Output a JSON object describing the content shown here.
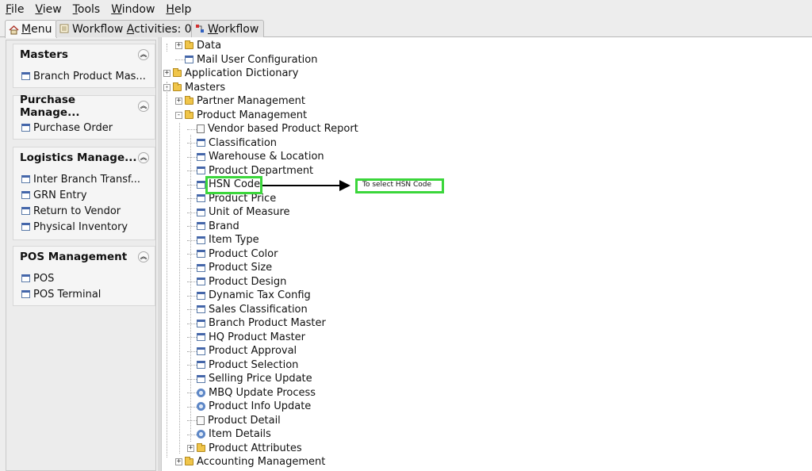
{
  "menubar": [
    {
      "pre": "",
      "ul": "F",
      "post": "ile"
    },
    {
      "pre": "",
      "ul": "V",
      "post": "iew"
    },
    {
      "pre": "",
      "ul": "T",
      "post": "ools"
    },
    {
      "pre": "",
      "ul": "W",
      "post": "indow"
    },
    {
      "pre": "",
      "ul": "H",
      "post": "elp"
    }
  ],
  "tabs": [
    {
      "label_ul": "M",
      "label_rest": "enu",
      "icon": "home-icon"
    },
    {
      "label_pre": "Workflow ",
      "label_ul": "A",
      "label_rest": "ctivities: 0",
      "icon": "list-icon"
    },
    {
      "label_ul": "W",
      "label_rest": "orkflow",
      "icon": "workflow-icon"
    }
  ],
  "sections": [
    {
      "title": "Masters",
      "items": [
        {
          "label": "Branch Product Mas...",
          "icon": "window-icon"
        }
      ]
    },
    {
      "title": "Purchase Manage...",
      "items": [
        {
          "label": "Purchase Order",
          "icon": "window-icon"
        }
      ]
    },
    {
      "title": "Logistics Manage...",
      "items": [
        {
          "label": "Inter Branch Transf...",
          "icon": "window-icon"
        },
        {
          "label": "GRN Entry",
          "icon": "window-icon"
        },
        {
          "label": "Return to Vendor",
          "icon": "window-icon"
        },
        {
          "label": "Physical Inventory",
          "icon": "window-icon"
        }
      ]
    },
    {
      "title": "POS Management",
      "items": [
        {
          "label": "POS",
          "icon": "window-icon"
        },
        {
          "label": "POS Terminal",
          "icon": "window-icon"
        }
      ]
    }
  ],
  "tree": [
    {
      "label": "Data",
      "icon": "folder",
      "expander": "+",
      "level": 1
    },
    {
      "label": "Mail User Configuration",
      "icon": "window",
      "expander": "",
      "level": 1
    },
    {
      "label": "Application Dictionary",
      "icon": "folder",
      "expander": "+",
      "level": 0
    },
    {
      "label": "Masters",
      "icon": "folder-open",
      "expander": "-",
      "level": 0
    },
    {
      "label": "Partner Management",
      "icon": "folder",
      "expander": "+",
      "level": 1
    },
    {
      "label": "Product Management",
      "icon": "folder-open",
      "expander": "-",
      "level": 1
    },
    {
      "label": "Vendor based Product Report",
      "icon": "doc",
      "expander": "",
      "level": 2
    },
    {
      "label": "Classification",
      "icon": "window",
      "expander": "",
      "level": 2
    },
    {
      "label": "Warehouse & Location",
      "icon": "window",
      "expander": "",
      "level": 2
    },
    {
      "label": "Product Department",
      "icon": "window",
      "expander": "",
      "level": 2
    },
    {
      "label": "HSN Code",
      "icon": "window",
      "expander": "",
      "level": 2
    },
    {
      "label": "Product Price",
      "icon": "window",
      "expander": "",
      "level": 2
    },
    {
      "label": "Unit of Measure",
      "icon": "window",
      "expander": "",
      "level": 2
    },
    {
      "label": "Brand",
      "icon": "window",
      "expander": "",
      "level": 2
    },
    {
      "label": "Item Type",
      "icon": "window",
      "expander": "",
      "level": 2
    },
    {
      "label": "Product Color",
      "icon": "window",
      "expander": "",
      "level": 2
    },
    {
      "label": "Product Size",
      "icon": "window",
      "expander": "",
      "level": 2
    },
    {
      "label": "Product Design",
      "icon": "window",
      "expander": "",
      "level": 2
    },
    {
      "label": "Dynamic Tax Config",
      "icon": "window",
      "expander": "",
      "level": 2
    },
    {
      "label": "Sales Classification",
      "icon": "window",
      "expander": "",
      "level": 2
    },
    {
      "label": "Branch Product Master",
      "icon": "window",
      "expander": "",
      "level": 2
    },
    {
      "label": "HQ Product Master",
      "icon": "window",
      "expander": "",
      "level": 2
    },
    {
      "label": "Product Approval",
      "icon": "window",
      "expander": "",
      "level": 2
    },
    {
      "label": "Product Selection",
      "icon": "window",
      "expander": "",
      "level": 2
    },
    {
      "label": "Selling Price Update",
      "icon": "window",
      "expander": "",
      "level": 2
    },
    {
      "label": "MBQ Update Process",
      "icon": "gear",
      "expander": "",
      "level": 2
    },
    {
      "label": "Product Info Update",
      "icon": "gear",
      "expander": "",
      "level": 2
    },
    {
      "label": "Product Detail",
      "icon": "doc",
      "expander": "",
      "level": 2
    },
    {
      "label": "Item Details",
      "icon": "gear",
      "expander": "",
      "level": 2
    },
    {
      "label": "Product Attributes",
      "icon": "folder",
      "expander": "+",
      "level": 2
    },
    {
      "label": "Accounting Management",
      "icon": "folder",
      "expander": "+",
      "level": 1
    }
  ],
  "annotation": {
    "text": "To select HSN Code",
    "target": "HSN Code",
    "color": "#3bd63b"
  }
}
